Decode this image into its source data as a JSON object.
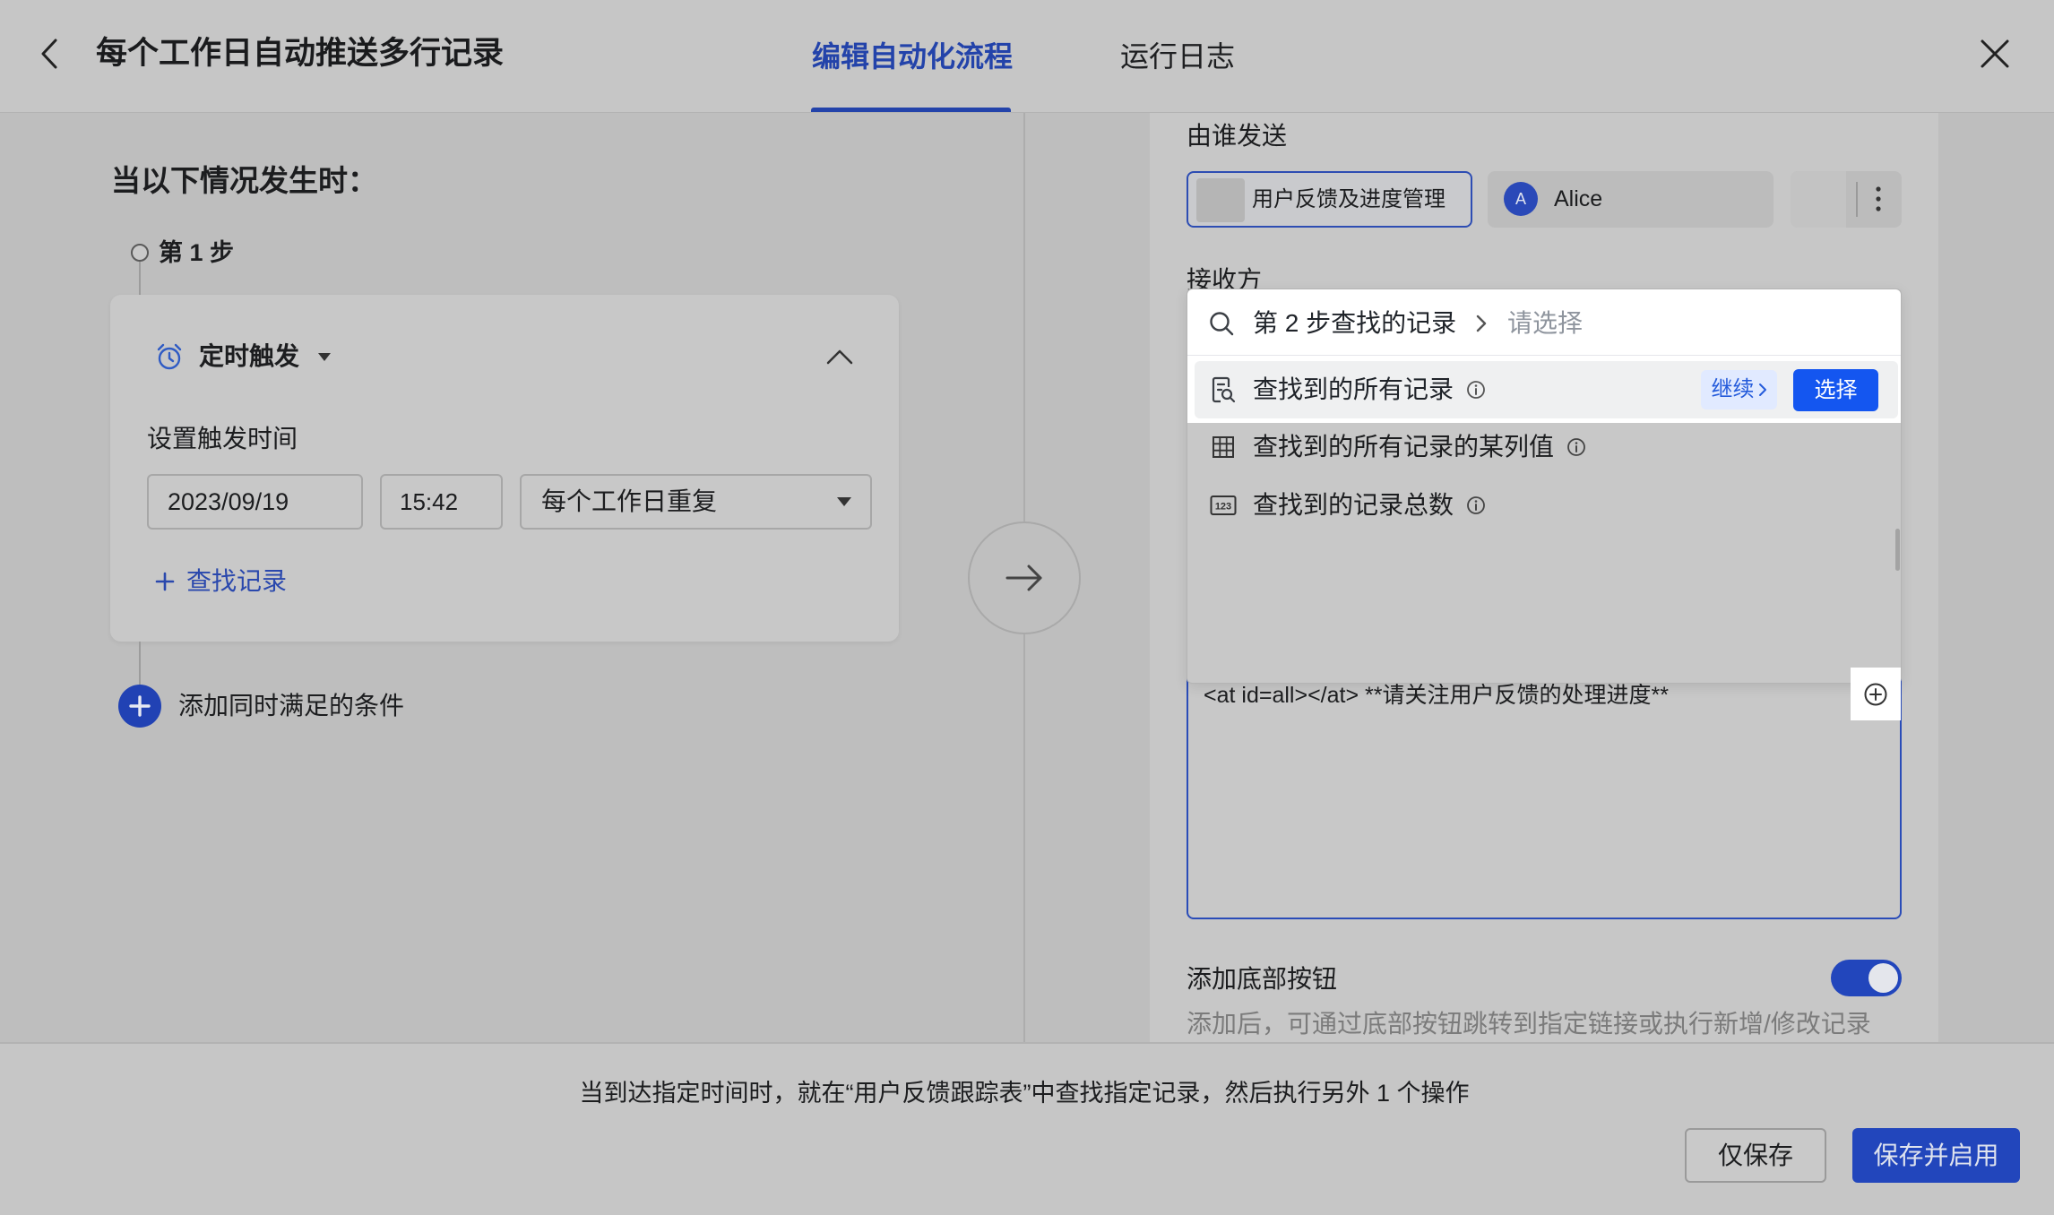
{
  "header": {
    "title": "每个工作日自动推送多行记录",
    "tabs": [
      {
        "label": "编辑自动化流程",
        "active": true
      },
      {
        "label": "运行日志",
        "active": false
      }
    ]
  },
  "trigger": {
    "heading": "当以下情况发生时：",
    "step_label": "第 1 步",
    "icon": "alarm-clock-icon",
    "type_label": "定时触发",
    "time_label": "设置触发时间",
    "date_value": "2023/09/19",
    "time_value": "15:42",
    "repeat_value": "每个工作日重复",
    "find_records_label": "查找记录",
    "add_condition_label": "添加同时满足的条件"
  },
  "action": {
    "sender_label": "由谁发送",
    "sender_bot": "用户反馈及进度管理",
    "sender_user": {
      "initial": "A",
      "name": "Alice"
    },
    "receiver_label": "接收方",
    "message_text": "<at id=all></at> **请关注用户反馈的处理进度**",
    "bottom_button": {
      "label": "添加底部按钮",
      "help": "添加后，可通过底部按钮跳转到指定链接或执行新增/修改记录",
      "enabled": true
    }
  },
  "record_picker": {
    "search": {
      "source": "第 2 步查找的记录",
      "placeholder": "请选择"
    },
    "options": [
      {
        "label": "查找到的所有记录",
        "icon": "record-search-icon",
        "continue_label": "继续",
        "select_label": "选择",
        "highlighted": true
      },
      {
        "label": "查找到的所有记录的某列值",
        "icon": "table-grid-icon"
      },
      {
        "label": "查找到的记录总数",
        "icon": "number-123-icon",
        "icon_text": "123"
      }
    ]
  },
  "footer": {
    "summary": "当到达指定时间时，就在“用户反馈跟踪表”中查找指定记录，然后执行另外 1 个操作",
    "save_label": "仅保存",
    "save_enable_label": "保存并启用"
  },
  "colors": {
    "accent": "#1456f0",
    "accent_light": "#e1eaff",
    "accent_text": "#245bdb",
    "dimmed_accent": "#2246bc"
  }
}
